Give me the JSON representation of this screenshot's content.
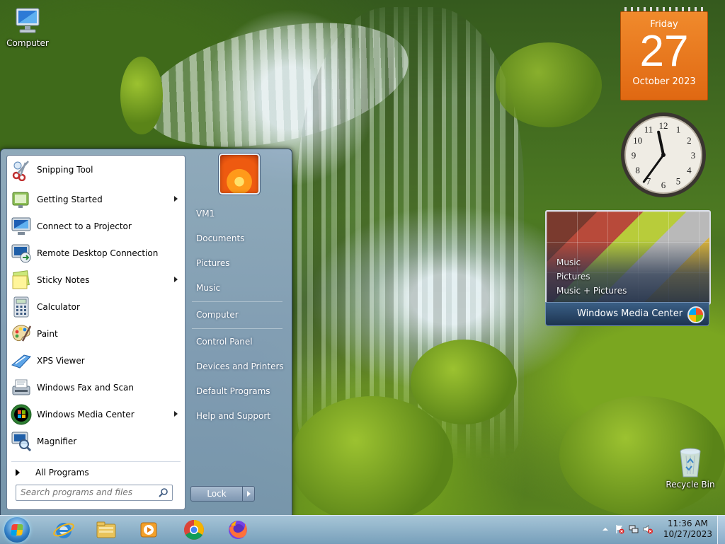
{
  "desktop": {
    "icons": [
      {
        "label": "Computer"
      },
      {
        "label": "Recycle Bin"
      }
    ]
  },
  "gadgets": {
    "calendar": {
      "weekday": "Friday",
      "day": "27",
      "month_year": "October 2023"
    },
    "clock": {
      "hour": 11,
      "minute": 36,
      "numerals": [
        "12",
        "1",
        "2",
        "3",
        "4",
        "5",
        "6",
        "7",
        "8",
        "9",
        "10",
        "11"
      ]
    },
    "media_center": {
      "items": [
        "Music",
        "Pictures",
        "Music + Pictures"
      ],
      "brand": "Windows Media Center"
    }
  },
  "start_menu": {
    "programs": [
      {
        "label": "Snipping Tool",
        "icon": "scissors-icon",
        "submenu": false
      },
      {
        "label": "Getting Started",
        "icon": "getting-started-icon",
        "submenu": true
      },
      {
        "label": "Connect to a Projector",
        "icon": "projector-icon",
        "submenu": false
      },
      {
        "label": "Remote Desktop Connection",
        "icon": "remote-desktop-icon",
        "submenu": false
      },
      {
        "label": "Sticky Notes",
        "icon": "sticky-notes-icon",
        "submenu": true
      },
      {
        "label": "Calculator",
        "icon": "calculator-icon",
        "submenu": false
      },
      {
        "label": "Paint",
        "icon": "paint-palette-icon",
        "submenu": false
      },
      {
        "label": "XPS Viewer",
        "icon": "xps-viewer-icon",
        "submenu": false
      },
      {
        "label": "Windows Fax and Scan",
        "icon": "fax-icon",
        "submenu": false
      },
      {
        "label": "Windows Media Center",
        "icon": "media-center-icon",
        "submenu": true
      },
      {
        "label": "Magnifier",
        "icon": "magnifier-icon",
        "submenu": false
      }
    ],
    "all_programs": "All Programs",
    "search_placeholder": "Search programs and files",
    "right_links": [
      {
        "label": "VM1"
      },
      {
        "label": "Documents"
      },
      {
        "label": "Pictures"
      },
      {
        "label": "Music"
      },
      {
        "label": "Computer"
      },
      {
        "label": "Control Panel"
      },
      {
        "label": "Devices and Printers"
      },
      {
        "label": "Default Programs"
      },
      {
        "label": "Help and Support"
      }
    ],
    "lock_label": "Lock"
  },
  "taskbar": {
    "apps": [
      "internet-explorer-icon",
      "file-explorer-icon",
      "media-player-icon",
      "chrome-icon",
      "firefox-icon"
    ],
    "time": "11:36 AM",
    "date": "10/27/2023"
  },
  "colors": {
    "calendar": "#e8761c",
    "taskbar": "#9fbfdc"
  }
}
